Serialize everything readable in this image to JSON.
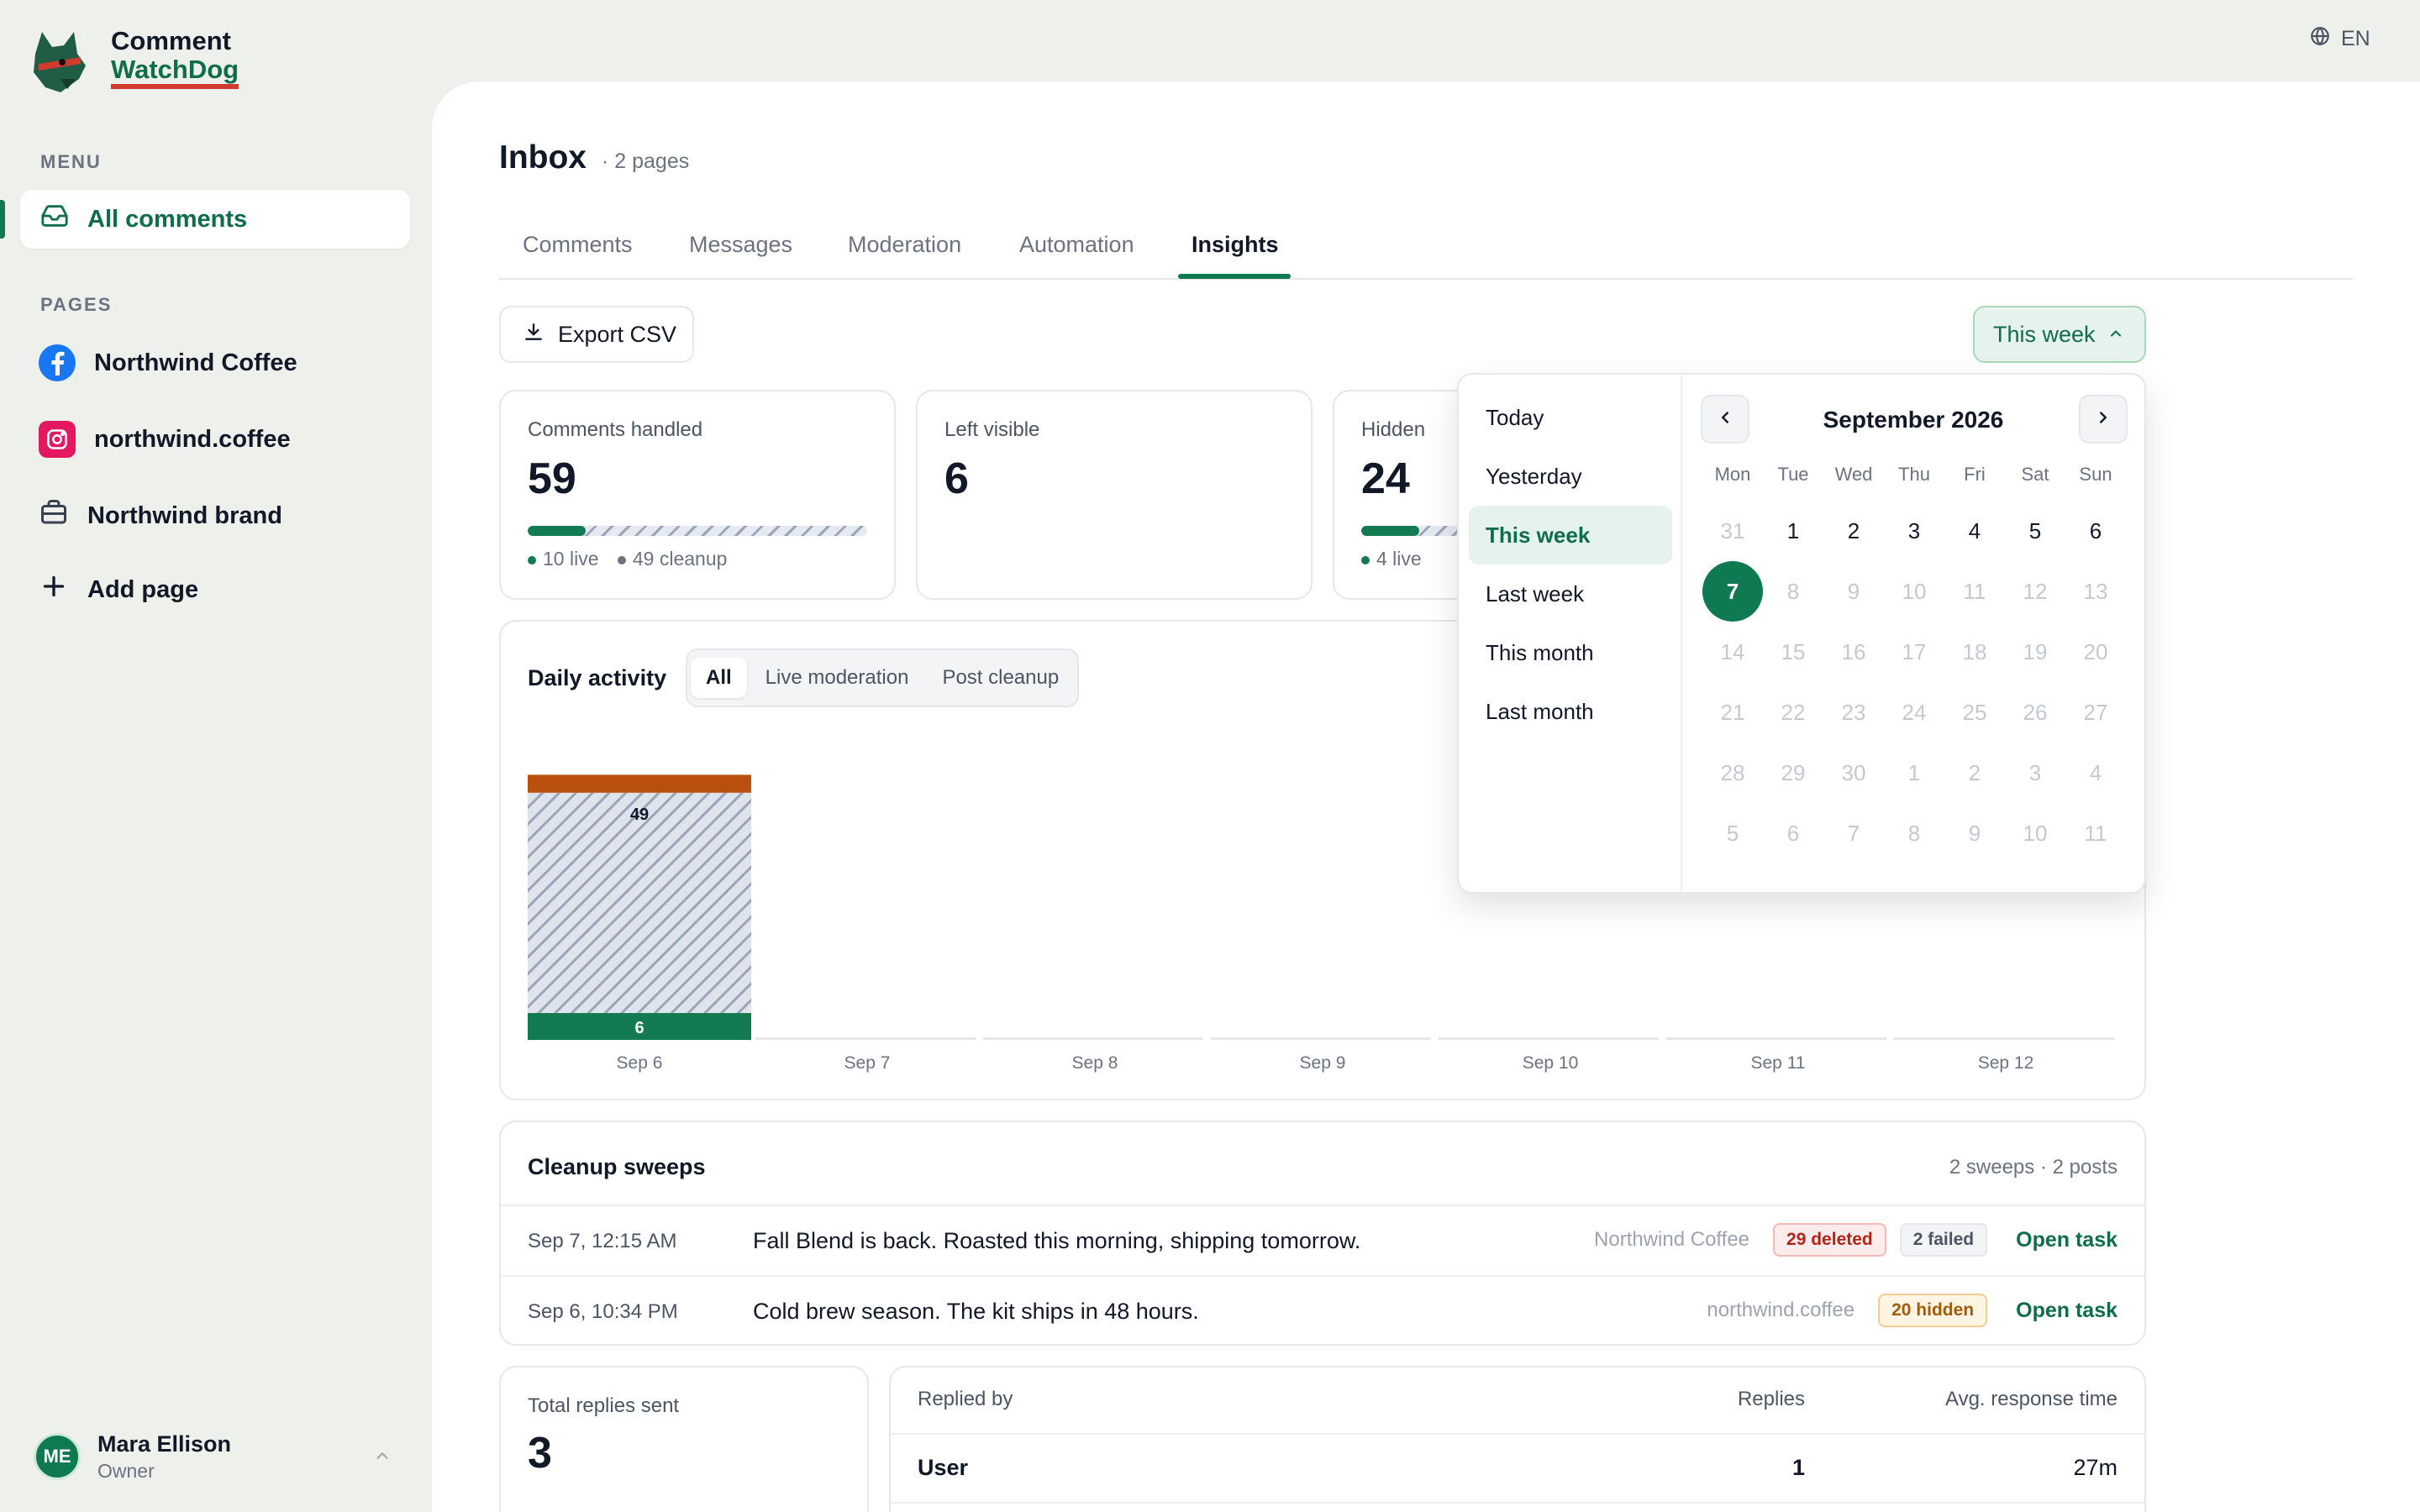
{
  "app": {
    "name_line1": "Comment",
    "name_line2": "WatchDog",
    "language": "EN",
    "colors": {
      "brand": "#0f7a52",
      "accent_red": "#d13b2f",
      "cleanup": "#b9500e"
    }
  },
  "sidebar": {
    "menu_heading": "MENU",
    "menu_items": [
      {
        "label": "All comments",
        "icon": "inbox-icon"
      }
    ],
    "pages_heading": "PAGES",
    "pages": [
      {
        "label": "Northwind Coffee",
        "icon": "facebook-icon"
      },
      {
        "label": "northwind.coffee",
        "icon": "instagram-icon"
      },
      {
        "label": "Northwind brand",
        "icon": "briefcase-icon"
      }
    ],
    "add_page_label": "Add page",
    "user": {
      "initials": "ME",
      "name": "Mara Ellison",
      "role": "Owner"
    }
  },
  "header": {
    "title": "Inbox",
    "subtitle": "· 2 pages"
  },
  "tabs": [
    "Comments",
    "Messages",
    "Moderation",
    "Automation",
    "Insights"
  ],
  "active_tab": "Insights",
  "toolbar": {
    "export_label": "Export CSV",
    "range_label": "This week"
  },
  "stats": [
    {
      "label": "Comments handled",
      "value": "59",
      "legend": [
        "10 live",
        "49 cleanup"
      ],
      "live_fraction": 0.17
    },
    {
      "label": "Left visible",
      "value": "6"
    },
    {
      "label": "Hidden",
      "value": "24",
      "legend": [
        "4 live"
      ],
      "live_fraction": 0.17
    }
  ],
  "daily_activity": {
    "title": "Daily activity",
    "filters": [
      "All",
      "Live moderation",
      "Post cleanup"
    ],
    "active_filter": "All"
  },
  "chart_data": {
    "type": "bar",
    "categories": [
      "Sep 6",
      "Sep 7",
      "Sep 8",
      "Sep 9",
      "Sep 10",
      "Sep 11",
      "Sep 12"
    ],
    "series": [
      {
        "values": [
          6,
          0,
          0,
          0,
          0,
          0,
          0
        ],
        "color": "#137a52"
      },
      {
        "values": [
          49,
          0,
          0,
          0,
          0,
          0,
          0
        ],
        "color": "#dfe4ec"
      },
      {
        "values": [
          4,
          0,
          0,
          0,
          0,
          0,
          0
        ],
        "color": "#b9500e"
      }
    ],
    "data_labels": [
      "6",
      "49"
    ]
  },
  "date_picker": {
    "presets": [
      "Today",
      "Yesterday",
      "This week",
      "Last week",
      "This month",
      "Last month"
    ],
    "active_preset": "This week",
    "month_label": "September 2026",
    "weekdays": [
      "Mon",
      "Tue",
      "Wed",
      "Thu",
      "Fri",
      "Sat",
      "Sun"
    ],
    "weeks": [
      [
        "31",
        "1",
        "2",
        "3",
        "4",
        "5",
        "6"
      ],
      [
        "7",
        "8",
        "9",
        "10",
        "11",
        "12",
        "13"
      ],
      [
        "14",
        "15",
        "16",
        "17",
        "18",
        "19",
        "20"
      ],
      [
        "21",
        "22",
        "23",
        "24",
        "25",
        "26",
        "27"
      ],
      [
        "28",
        "29",
        "30",
        "1",
        "2",
        "3",
        "4"
      ],
      [
        "5",
        "6",
        "7",
        "8",
        "9",
        "10",
        "11"
      ]
    ],
    "selected_day": "7"
  },
  "cleanup": {
    "title": "Cleanup sweeps",
    "summary": "2 sweeps · 2 posts",
    "rows": [
      {
        "date": "Sep 7, 12:15 AM",
        "text": "Fall Blend is back. Roasted this morning, shipping tomorrow.",
        "page": "Northwind Coffee",
        "badges": [
          "29 deleted",
          "2 failed"
        ],
        "action": "Open task"
      },
      {
        "date": "Sep 6, 10:34 PM",
        "text": "Cold brew season. The kit ships in 48 hours.",
        "page": "northwind.coffee",
        "badges": [
          "20 hidden"
        ],
        "action": "Open task"
      }
    ]
  },
  "replies": {
    "total_label": "Total replies sent",
    "total_value": "3",
    "table_headers": [
      "Replied by",
      "Replies",
      "Avg. response time"
    ],
    "rows": [
      {
        "by": "User",
        "replies": "1",
        "avg": "27m"
      }
    ]
  }
}
